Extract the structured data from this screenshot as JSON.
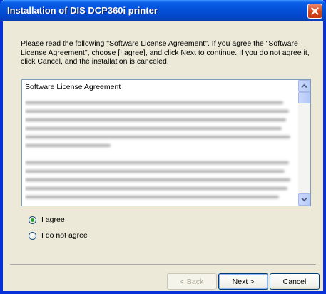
{
  "window": {
    "title": "Installation of DIS DCP360i printer"
  },
  "instructions": "Please read the following \"Software License Agreement\".  If you agree the \"Software License Agreement\", choose [I agree], and click Next to continue. If you do not agree it, click Cancel, and the installation is canceled.",
  "license": {
    "heading": "Software License Agreement"
  },
  "options": [
    {
      "label": "I agree",
      "selected": true
    },
    {
      "label": "I do not agree",
      "selected": false
    }
  ],
  "buttons": {
    "back": "< Back",
    "next": "Next >",
    "cancel": "Cancel"
  },
  "colors": {
    "title_bar": "#0351d9",
    "dialog_face": "#ece9d8",
    "close_button": "#d6461b",
    "radio_dot": "#21a121"
  }
}
